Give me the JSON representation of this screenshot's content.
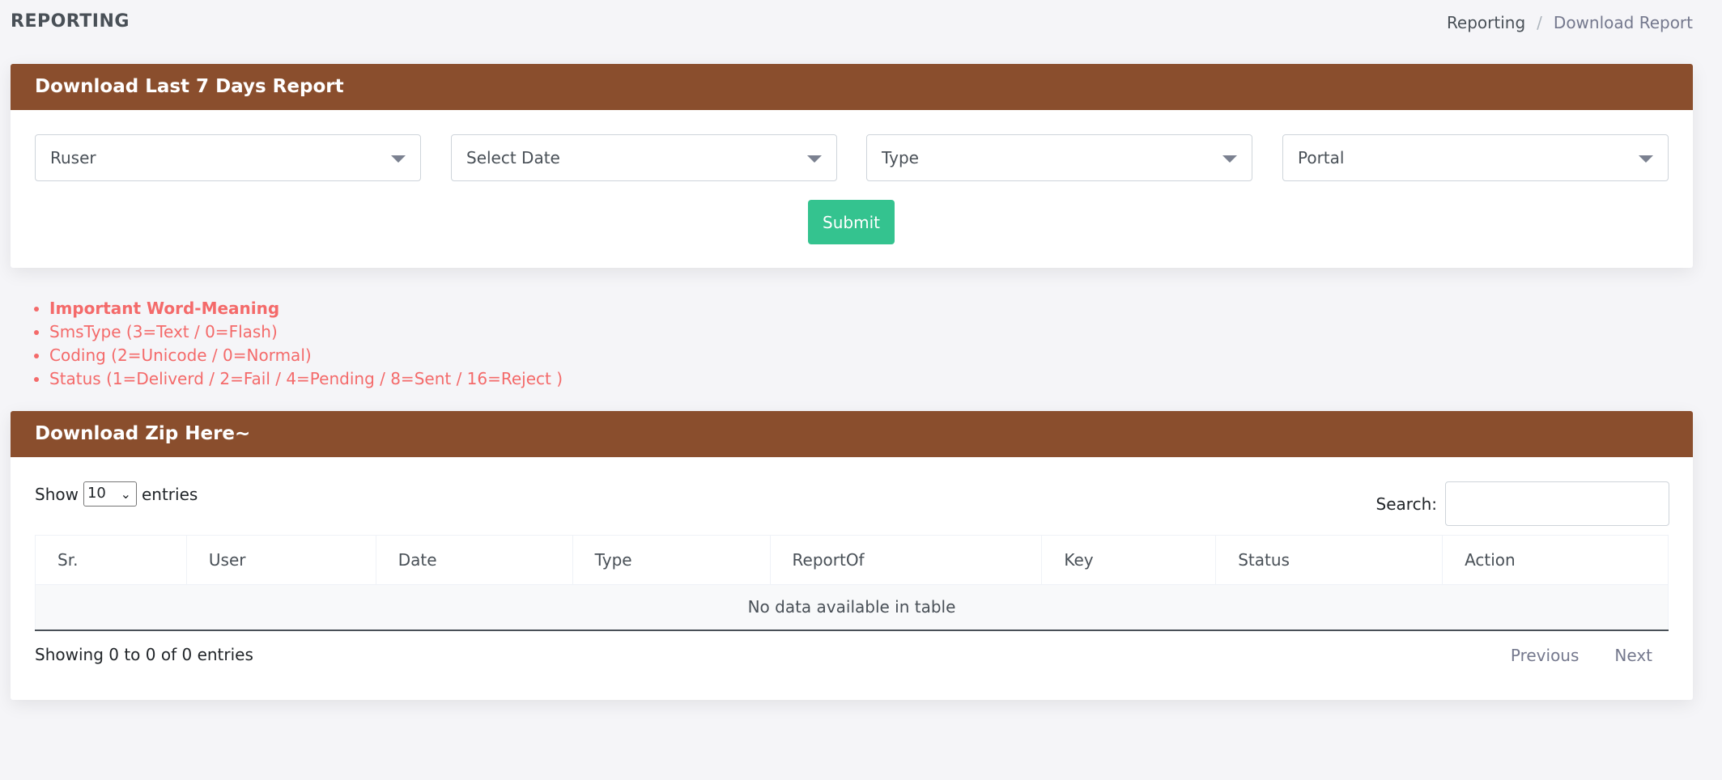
{
  "header": {
    "title": "REPORTING",
    "breadcrumb": [
      "Reporting",
      "/",
      "Download Report"
    ]
  },
  "report_card": {
    "title": "Download Last 7 Days Report",
    "filters": [
      "Ruser",
      "Select Date",
      "Type",
      "Portal"
    ],
    "submit_label": "Submit"
  },
  "legend": {
    "items": [
      "Important Word-Meaning",
      "SmsType (3=Text / 0=Flash)",
      "Coding (2=Unicode / 0=Normal)",
      "Status (1=Deliverd / 2=Fail / 4=Pending / 8=Sent / 16=Reject )"
    ]
  },
  "zip_card": {
    "title": "Download Zip Here~",
    "show_label": "Show",
    "page_length": "10",
    "entries_label": "entries",
    "search_label": "Search:",
    "columns": [
      "Sr.",
      "User",
      "Date",
      "Type",
      "ReportOf",
      "Key",
      "Status",
      "Action"
    ],
    "empty_text": "No data available in table",
    "info": "Showing 0 to 0 of 0 entries",
    "prev_label": "Previous",
    "next_label": "Next"
  },
  "colors": {
    "card_header": "#8a4e2d",
    "submit": "#34c38f",
    "legend_text": "#f46a6a"
  }
}
